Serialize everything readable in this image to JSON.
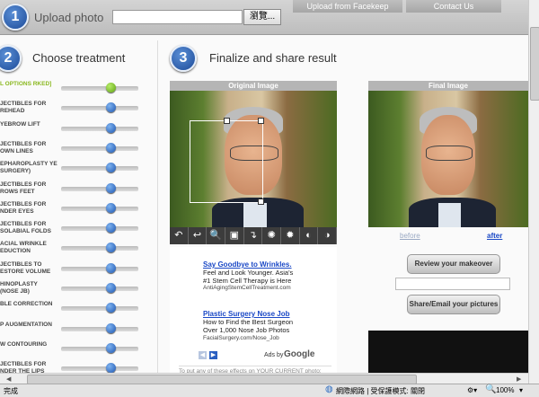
{
  "header": {
    "step1": {
      "num": "1",
      "title": "Upload photo"
    },
    "browse_label": "瀏覽...",
    "tabs": [
      "Upload from Facekeep",
      "Contact Us"
    ]
  },
  "step2": {
    "num": "2",
    "title": "Choose treatment"
  },
  "step3": {
    "num": "3",
    "title": "Finalize and share result"
  },
  "treatments": [
    {
      "label": "L OPTIONS RKED]",
      "active": true
    },
    {
      "label": "JECTIBLES FOR REHEAD",
      "active": false
    },
    {
      "label": "YEBROW LIFT",
      "active": false
    },
    {
      "label": "JECTIBLES FOR OWN LINES",
      "active": false
    },
    {
      "label": "EPHAROPLASTY YE SURGERY)",
      "active": false
    },
    {
      "label": "JECTIBLES FOR ROWS FEET",
      "active": false
    },
    {
      "label": "JECTIBLES FOR NDER EYES",
      "active": false
    },
    {
      "label": "JECTIBLES FOR SOLABIAL FOLDS",
      "active": false
    },
    {
      "label": "ACIAL WRINKLE EDUCTION",
      "active": false
    },
    {
      "label": "JECTIBLES TO ESTORE VOLUME",
      "active": false
    },
    {
      "label": "HINOPLASTY (NOSE JB)",
      "active": false
    },
    {
      "label": "BLE CORRECTION",
      "active": false
    },
    {
      "label": "P AUGMENTATION",
      "active": false
    },
    {
      "label": "W CONTOURING",
      "active": false
    },
    {
      "label": "JECTIBLES FOR NDER THE LIPS",
      "active": false
    }
  ],
  "original_image": {
    "header": "Original Image"
  },
  "final_image": {
    "header": "Final Image",
    "before_label": "before",
    "after_label": "after"
  },
  "tools": [
    "↶",
    "↩",
    "🔍",
    "▣",
    "↴",
    "✺",
    "✹",
    "◐",
    "◑"
  ],
  "ads": [
    {
      "title": "Say Goodbye to Wrinkles.",
      "line1": "Feel and Look Younger. Asia's",
      "line2": "#1 Stem Cell Therapy is Here",
      "url": "AntiAgingStemCellTreatment.com"
    },
    {
      "title": "Plastic Surgery Nose Job",
      "line1": "How to Find the Best Surgeon",
      "line2": "Over 1,000 Nose Job Photos",
      "url": "FacialSurgery.com/Nose_Job"
    }
  ],
  "ads_by": "Ads by",
  "ads_google": "Google",
  "ad_bottom_note": "To put any of these effects on YOUR CURRENT photo:",
  "buttons": {
    "review": "Review your makeover",
    "share": "Share/Email your pictures"
  },
  "statusbar": {
    "left": "完成",
    "zone": "網際網路 | 受保護模式: 關閉",
    "zoom": "100%"
  }
}
